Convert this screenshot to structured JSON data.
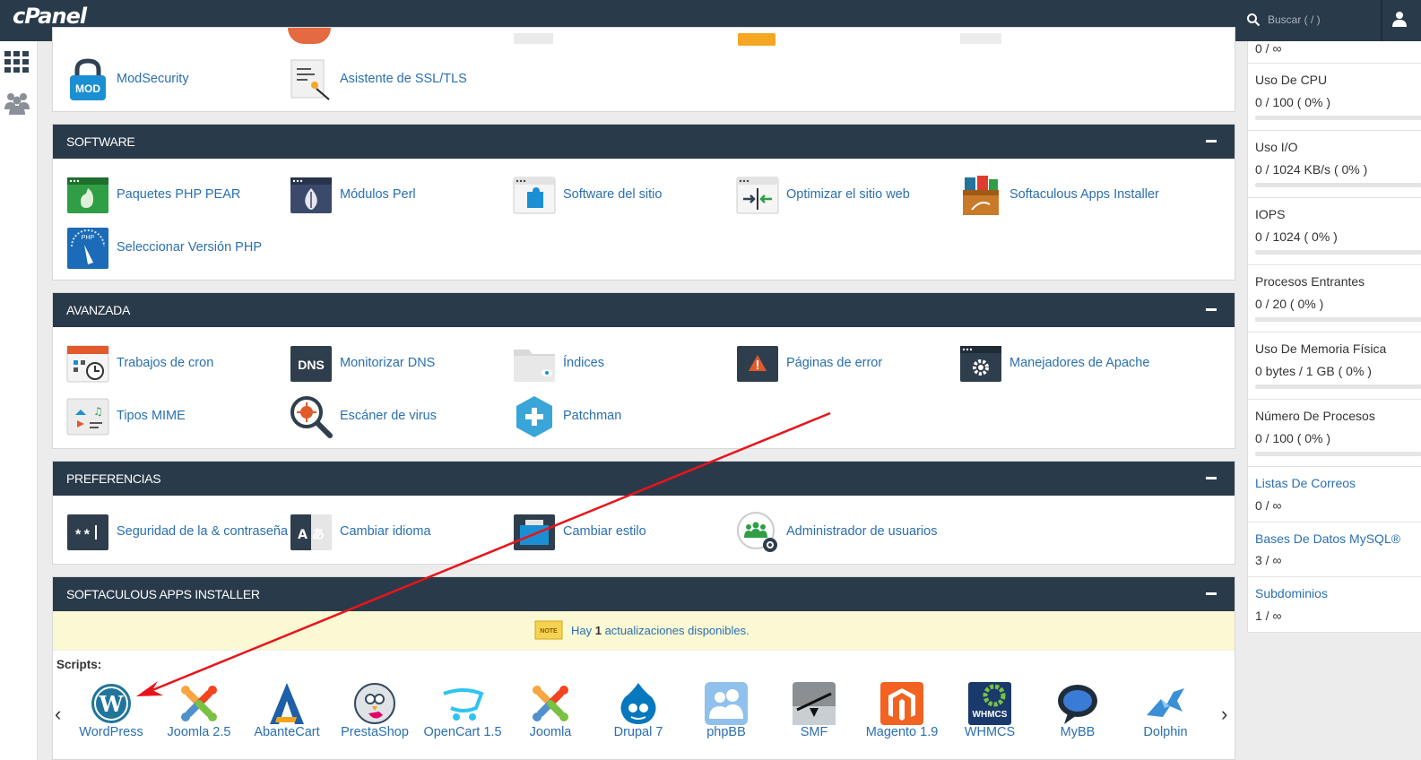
{
  "app": {
    "logo": "cPanel"
  },
  "search": {
    "placeholder": "Buscar ( / )"
  },
  "sidebar": {
    "icons": [
      "apps-grid-icon",
      "users-group-icon"
    ]
  },
  "stats": [
    {
      "label": "",
      "value": "0 / ∞",
      "bar": null
    },
    {
      "label": "Uso De CPU",
      "value": "0 / 100 ( 0% )",
      "bar": 0
    },
    {
      "label": "Uso I/O",
      "value": "0 / 1024 KB/s ( 0% )",
      "bar": 0
    },
    {
      "label": "IOPS",
      "value": "0 / 1024 ( 0% )",
      "bar": 0
    },
    {
      "label": "Procesos Entrantes",
      "value": "0 / 20 ( 0% )",
      "bar": 0
    },
    {
      "label": "Uso De Memoria Física",
      "value": "0 bytes / 1 GB ( 0% )",
      "bar": 0
    },
    {
      "label": "Número De Procesos",
      "value": "0 / 100 ( 0% )",
      "bar": 0
    },
    {
      "label": "Listas De Correos",
      "value": "0 / ∞",
      "link": true
    },
    {
      "label": "Bases De Datos MySQL®",
      "value": "3 / ∞",
      "link": true
    },
    {
      "label": "Subdominios",
      "value": "1 / ∞",
      "link": true
    }
  ],
  "security": {
    "items": [
      {
        "label": "ModSecurity",
        "icon": "mod-lock-icon"
      },
      {
        "label": "Asistente de SSL/TLS",
        "icon": "certificate-wizard-icon"
      }
    ]
  },
  "software": {
    "title": "SOFTWARE",
    "items": [
      {
        "label": "Paquetes PHP PEAR",
        "icon": "php-pear-icon"
      },
      {
        "label": "Módulos Perl",
        "icon": "perl-onion-icon"
      },
      {
        "label": "Software del sitio",
        "icon": "puzzle-piece-icon"
      },
      {
        "label": "Optimizar el sitio web",
        "icon": "compress-arrows-icon"
      },
      {
        "label": "Softaculous Apps Installer",
        "icon": "softaculous-box-icon"
      },
      {
        "label": "Seleccionar Versión PHP",
        "icon": "php-gauge-icon"
      }
    ]
  },
  "advanced": {
    "title": "AVANZADA",
    "items": [
      {
        "label": "Trabajos de cron",
        "icon": "calendar-clock-icon"
      },
      {
        "label": "Monitorizar DNS",
        "icon": "dns-icon",
        "badge": "DNS"
      },
      {
        "label": "Índices",
        "icon": "folder-eye-icon"
      },
      {
        "label": "Páginas de error",
        "icon": "warning-page-icon"
      },
      {
        "label": "Manejadores de Apache",
        "icon": "gear-window-icon"
      },
      {
        "label": "Tipos MIME",
        "icon": "mime-media-icon"
      },
      {
        "label": "Escáner de virus",
        "icon": "virus-magnifier-icon"
      },
      {
        "label": "Patchman",
        "icon": "patchman-hexagon-icon"
      }
    ]
  },
  "preferences": {
    "title": "PREFERENCIAS",
    "items": [
      {
        "label": "Seguridad de la & contraseña",
        "icon": "password-field-icon",
        "badge": "**"
      },
      {
        "label": "Cambiar idioma",
        "icon": "language-icon",
        "badge": "A あ"
      },
      {
        "label": "Cambiar estilo",
        "icon": "style-window-icon"
      },
      {
        "label": "Administrador de usuarios",
        "icon": "user-manager-icon"
      }
    ]
  },
  "softaculous": {
    "title": "SOFTACULOUS APPS INSTALLER",
    "notice_pre": "Hay ",
    "notice_count": "1",
    "notice_post": " actualizaciones disponibles.",
    "notice_icon_text": "NOTE",
    "scripts_label": "Scripts:",
    "prev": "‹",
    "next": "›",
    "scripts": [
      {
        "label": "WordPress",
        "icon": "wordpress-icon"
      },
      {
        "label": "Joomla 2.5",
        "icon": "joomla-icon"
      },
      {
        "label": "AbanteCart",
        "icon": "abantecart-icon"
      },
      {
        "label": "PrestaShop",
        "icon": "prestashop-icon"
      },
      {
        "label": "OpenCart 1.5",
        "icon": "opencart-icon"
      },
      {
        "label": "Joomla",
        "icon": "joomla-icon"
      },
      {
        "label": "Drupal 7",
        "icon": "drupal-icon"
      },
      {
        "label": "phpBB",
        "icon": "phpbb-icon"
      },
      {
        "label": "SMF",
        "icon": "smf-icon"
      },
      {
        "label": "Magento 1.9",
        "icon": "magento-icon"
      },
      {
        "label": "WHMCS",
        "icon": "whmcs-icon",
        "badge": "WHMCS"
      },
      {
        "label": "MyBB",
        "icon": "mybb-icon"
      },
      {
        "label": "Dolphin",
        "icon": "dolphin-icon"
      }
    ]
  },
  "colors": {
    "header": "#293a4a",
    "link": "#2a6fb0",
    "annotation": "#e8141b"
  }
}
